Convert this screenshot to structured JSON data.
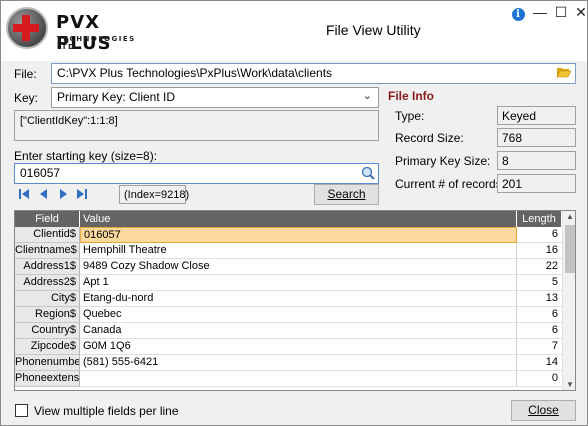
{
  "window": {
    "title": "File View Utility",
    "logo_name": "PVX PLUS",
    "logo_sub": "TECHNOLOGIES LTD."
  },
  "file": {
    "label": "File:",
    "value": "C:\\PVX Plus Technologies\\PxPlus\\Work\\data\\clients"
  },
  "key": {
    "label": "Key:",
    "selected": "Primary Key: Client ID",
    "definition": "[\"ClientIdKey\":1:1:8]"
  },
  "start_key": {
    "label": "Enter starting key (size=8):",
    "value": "016057"
  },
  "index_label": "(Index=9218)",
  "search_button": "Search",
  "file_info": {
    "heading": "File Info",
    "type_label": "Type:",
    "type_value": "Keyed",
    "record_size_label": "Record Size:",
    "record_size_value": "768",
    "primary_key_size_label": "Primary Key Size:",
    "primary_key_size_value": "8",
    "records_label": "Current # of records:",
    "records_value": "201"
  },
  "grid": {
    "headers": [
      "Field",
      "Value",
      "Length"
    ],
    "rows": [
      {
        "field": "Clientid$",
        "value": "016057",
        "length": "6"
      },
      {
        "field": "Clientname$",
        "value": "Hemphill Theatre",
        "length": "16"
      },
      {
        "field": "Address1$",
        "value": "9489 Cozy Shadow Close",
        "length": "22"
      },
      {
        "field": "Address2$",
        "value": "Apt 1",
        "length": "5"
      },
      {
        "field": "City$",
        "value": "Etang-du-nord",
        "length": "13"
      },
      {
        "field": "Region$",
        "value": "Quebec",
        "length": "6"
      },
      {
        "field": "Country$",
        "value": "Canada",
        "length": "6"
      },
      {
        "field": "Zipcode$",
        "value": "G0M 1Q6",
        "length": "7"
      },
      {
        "field": "Phonenumber$",
        "value": "(581) 555-6421",
        "length": "14"
      },
      {
        "field": "Phoneextension",
        "value": "",
        "length": "0"
      }
    ]
  },
  "multi_fields_label": "View multiple fields per line",
  "close_button": "Close"
}
